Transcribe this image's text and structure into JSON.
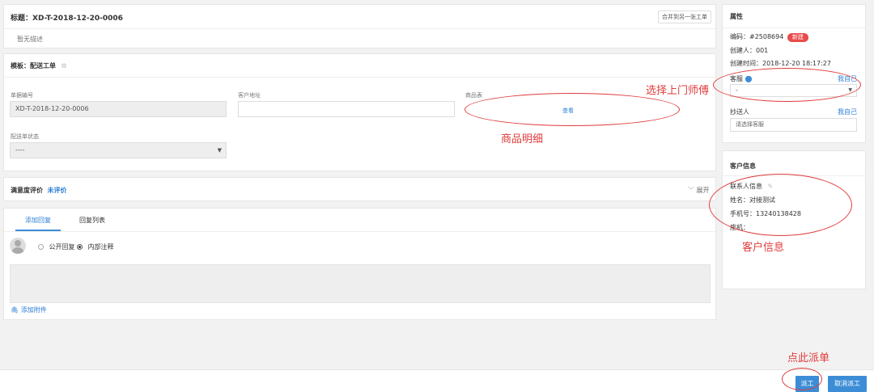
{
  "title_card": {
    "title": "标题：XD-T-2018-12-20-0006",
    "merge_button": "合并到另一张工单",
    "description": "暂无描述"
  },
  "template_card": {
    "label": "模板：配送工单",
    "fields": {
      "order_no": {
        "label": "单据编号",
        "value": "XD-T-2018-12-20-0006"
      },
      "address": {
        "label": "客户地址",
        "value": ""
      },
      "goods": {
        "label": "商品表",
        "view_label": "查看"
      },
      "status": {
        "label": "配送单状态",
        "value": "----"
      }
    }
  },
  "rating_card": {
    "label": "满意度评价",
    "value": "未评价",
    "expand": "展开"
  },
  "reply_card": {
    "tabs": [
      "添加回复",
      "回复列表"
    ],
    "radio_public": "公开回复",
    "radio_internal": "内部注释",
    "attach": "添加附件"
  },
  "attributes": {
    "header": "属性",
    "code": "编码：#2508694",
    "badge": "新建",
    "creator": "创建人：001",
    "created_time": "创建时间：2018-12-20 18:17:27",
    "service_label": "客服",
    "assign_self": "我自己",
    "service_value": "-",
    "cc_label": "抄送人",
    "cc_self": "我自己",
    "cc_placeholder": "请选择客服"
  },
  "customer": {
    "header": "客户信息",
    "contact_label": "联系人信息",
    "name": "姓名：对接测试",
    "phone": "手机号：13240138428",
    "landline": "座机："
  },
  "footer": {
    "dispatch": "派工",
    "cancel": "取消派工"
  },
  "annotations": {
    "select_master": "选择上门师傅",
    "goods_detail": "商品明细",
    "customer_info": "客户信息",
    "click_dispatch": "点此派单"
  },
  "colors": {
    "accent": "#3c8dd6",
    "badge": "#e94b4b",
    "annotation": "#e03b3b"
  }
}
